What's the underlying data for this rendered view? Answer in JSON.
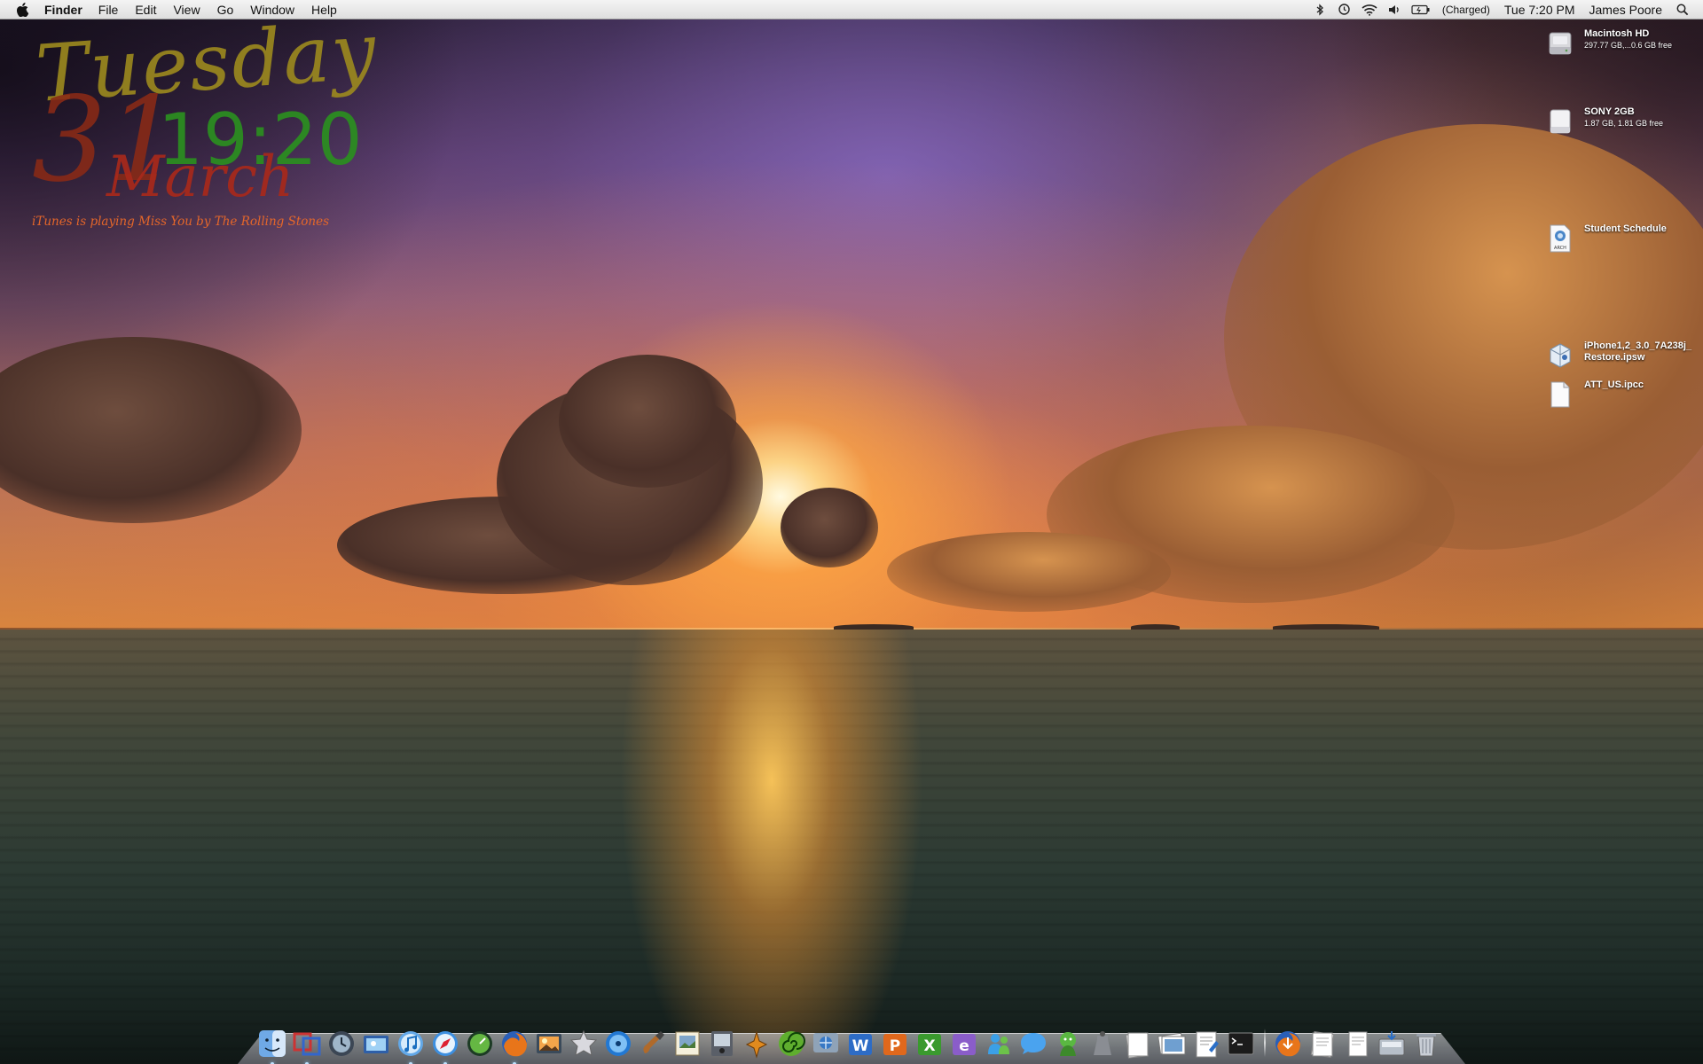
{
  "menubar": {
    "apple_icon": "apple-logo-icon",
    "app_name": "Finder",
    "menus": [
      "File",
      "Edit",
      "View",
      "Go",
      "Window",
      "Help"
    ],
    "status": {
      "bluetooth_icon": "bluetooth-icon",
      "time_machine_icon": "time-machine-icon",
      "wifi_icon": "wifi-icon",
      "volume_icon": "volume-icon",
      "battery_icon": "battery-icon",
      "battery_text": "(Charged)",
      "clock": "Tue 7:20 PM",
      "user": "James Poore",
      "spotlight_icon": "spotlight-search-icon"
    }
  },
  "widget": {
    "day": "Tuesday",
    "date": "31",
    "time": "19:20",
    "month": "March",
    "now_playing": "iTunes is playing Miss You by The Rolling Stones"
  },
  "desktop_icons": [
    {
      "name": "Macintosh HD",
      "sub": "297.77 GB,...0.6 GB free",
      "icon": "hard-drive-icon"
    },
    {
      "name": "SONY 2GB",
      "sub": "1.87 GB, 1.81 GB free",
      "icon": "usb-drive-icon"
    },
    {
      "name": "Student Schedule",
      "sub": "",
      "icon": "archive-file-icon"
    },
    {
      "name": "iPhone1,2_3.0_7A238j_",
      "sub": "Restore.ipsw",
      "icon": "ipsw-file-icon"
    },
    {
      "name": "ATT_US.ipcc",
      "sub": "",
      "icon": "document-icon"
    }
  ],
  "dock": {
    "apps": [
      {
        "name": "Finder",
        "icon": "finder-icon",
        "running": true
      },
      {
        "name": "Parallels",
        "icon": "parallels-icon",
        "running": true
      },
      {
        "name": "Time Machine",
        "icon": "time-machine-icon",
        "running": false
      },
      {
        "name": "Preview",
        "icon": "preview-icon",
        "running": false
      },
      {
        "name": "iTunes",
        "icon": "itunes-icon",
        "running": true
      },
      {
        "name": "Safari",
        "icon": "safari-icon",
        "running": true
      },
      {
        "name": "Dashboard",
        "icon": "dashboard-icon",
        "running": false
      },
      {
        "name": "Firefox",
        "icon": "firefox-icon",
        "running": true
      },
      {
        "name": "iPhoto",
        "icon": "iphoto-icon",
        "running": false
      },
      {
        "name": "iMovie",
        "icon": "imovie-icon",
        "running": false
      },
      {
        "name": "DVD Player",
        "icon": "dvd-player-icon",
        "running": false
      },
      {
        "name": "GarageBand",
        "icon": "garageband-icon",
        "running": false
      },
      {
        "name": "Preview Photos",
        "icon": "preview-photos-icon",
        "running": false
      },
      {
        "name": "Screen Capture",
        "icon": "screen-capture-icon",
        "running": false
      },
      {
        "name": "Teaching",
        "icon": "tools-icon",
        "running": false
      },
      {
        "name": "Spiral",
        "icon": "spiral-app-icon",
        "running": false
      },
      {
        "name": "Network",
        "icon": "network-icon",
        "running": false
      },
      {
        "name": "Word",
        "icon": "word-icon",
        "running": false
      },
      {
        "name": "PowerPoint",
        "icon": "powerpoint-icon",
        "running": false
      },
      {
        "name": "Excel",
        "icon": "excel-icon",
        "running": false
      },
      {
        "name": "Entourage",
        "icon": "entourage-icon",
        "running": false
      },
      {
        "name": "Messenger",
        "icon": "messenger-icon",
        "running": false
      },
      {
        "name": "iChat",
        "icon": "ichat-icon",
        "running": false
      },
      {
        "name": "Adium",
        "icon": "adium-icon",
        "running": false
      },
      {
        "name": "Automator",
        "icon": "automator-icon",
        "running": false
      },
      {
        "name": "Document",
        "icon": "document-stack-icon",
        "running": false
      },
      {
        "name": "Photo Library",
        "icon": "photo-library-icon",
        "running": false
      },
      {
        "name": "Pages",
        "icon": "pages-icon",
        "running": false
      },
      {
        "name": "Terminal",
        "icon": "terminal-icon",
        "running": false
      }
    ],
    "stacks": [
      {
        "name": "Firefox Downloads",
        "icon": "firefox-downloads-icon"
      },
      {
        "name": "Documents",
        "icon": "documents-stack-icon"
      },
      {
        "name": "File",
        "icon": "file-stack-icon"
      },
      {
        "name": "Downloads",
        "icon": "downloads-stack-icon"
      },
      {
        "name": "Trash",
        "icon": "trash-icon"
      }
    ]
  }
}
